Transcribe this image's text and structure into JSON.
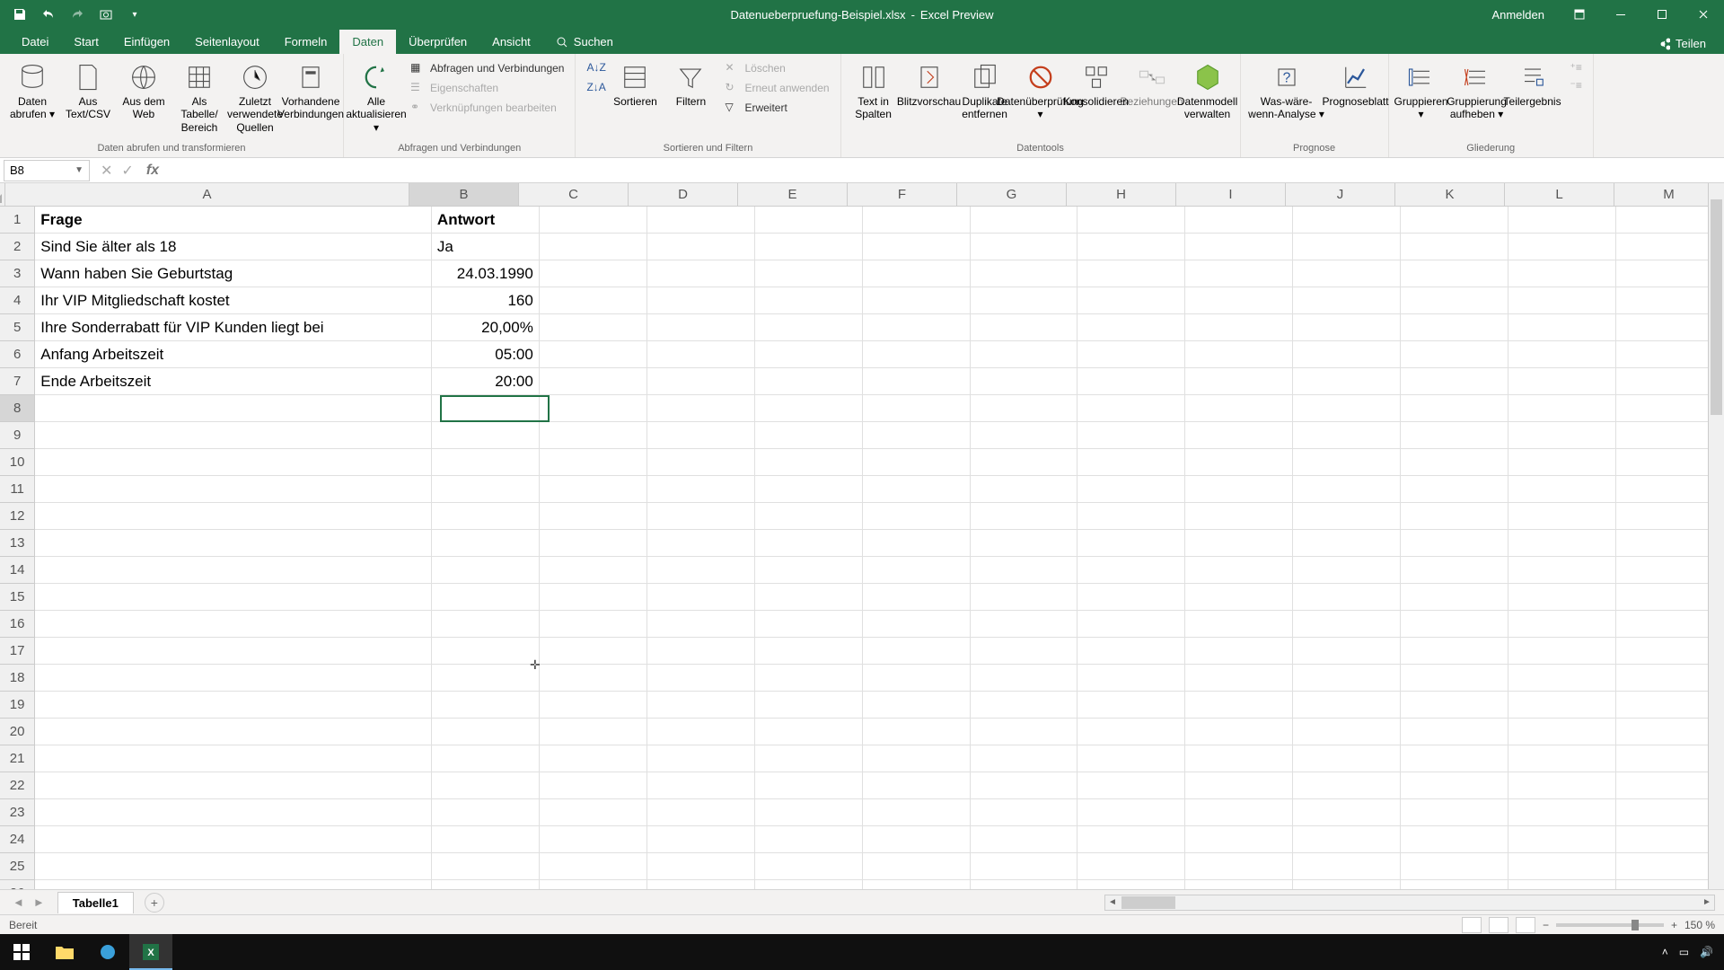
{
  "title": {
    "filename": "Datenueberpruefung-Beispiel.xlsx",
    "app": "Excel Preview"
  },
  "account": {
    "signin": "Anmelden"
  },
  "menu": {
    "file": "Datei",
    "home": "Start",
    "insert": "Einfügen",
    "layout": "Seitenlayout",
    "formulas": "Formeln",
    "data": "Daten",
    "review": "Überprüfen",
    "view": "Ansicht",
    "search": "Suchen",
    "share": "Teilen"
  },
  "ribbon": {
    "g1": {
      "get": "Daten abrufen ▾",
      "csv": "Aus Text/CSV",
      "web": "Aus dem Web",
      "table": "Als Tabelle/ Bereich",
      "recent": "Zuletzt verwendete Quellen",
      "existing": "Vorhandene Verbindungen",
      "label": "Daten abrufen und transformieren"
    },
    "g2": {
      "refresh": "Alle aktualisieren ▾",
      "queries": "Abfragen und Verbindungen",
      "props": "Eigenschaften",
      "links": "Verknüpfungen bearbeiten",
      "label": "Abfragen und Verbindungen"
    },
    "g3": {
      "sort": "Sortieren",
      "filter": "Filtern",
      "clear": "Löschen",
      "reapply": "Erneut anwenden",
      "adv": "Erweitert",
      "label": "Sortieren und Filtern"
    },
    "g4": {
      "ttc": "Text in Spalten",
      "flash": "Blitzvorschau",
      "dup": "Duplikate entfernen",
      "val": "Datenüberprüfung ▾",
      "cons": "Konsolidieren",
      "rel": "Beziehungen",
      "model": "Datenmodell verwalten",
      "label": "Datentools"
    },
    "g5": {
      "what": "Was-wäre-wenn-Analyse ▾",
      "fore": "Prognoseblatt",
      "label": "Prognose"
    },
    "g6": {
      "grp": "Gruppieren ▾",
      "ungrp": "Gruppierung aufheben ▾",
      "sub": "Teilergebnis",
      "label": "Gliederung"
    }
  },
  "namebox": "B8",
  "columns": [
    "A",
    "B",
    "C",
    "D",
    "E",
    "F",
    "G",
    "H",
    "I",
    "J",
    "K",
    "L",
    "M"
  ],
  "rows_header_count": 26,
  "selected": {
    "col": "B",
    "row": 8
  },
  "sheet_tab": "Tabelle1",
  "status": "Bereit",
  "zoom": "150 %",
  "tray_time": "",
  "data_rows": [
    {
      "a": "Frage",
      "b": "Antwort",
      "bold": true,
      "b_align": "left"
    },
    {
      "a": "Sind Sie älter als 18",
      "b": "Ja",
      "b_align": "left"
    },
    {
      "a": "Wann haben Sie Geburtstag",
      "b": "24.03.1990",
      "b_align": "right"
    },
    {
      "a": "Ihr VIP Mitgliedschaft kostet",
      "b": "160",
      "b_align": "right"
    },
    {
      "a": "Ihre Sonderrabatt für VIP Kunden liegt bei",
      "b": "20,00%",
      "b_align": "right"
    },
    {
      "a": "Anfang Arbeitszeit",
      "b": "05:00",
      "b_align": "right"
    },
    {
      "a": "Ende Arbeitszeit",
      "b": "20:00",
      "b_align": "right"
    }
  ]
}
